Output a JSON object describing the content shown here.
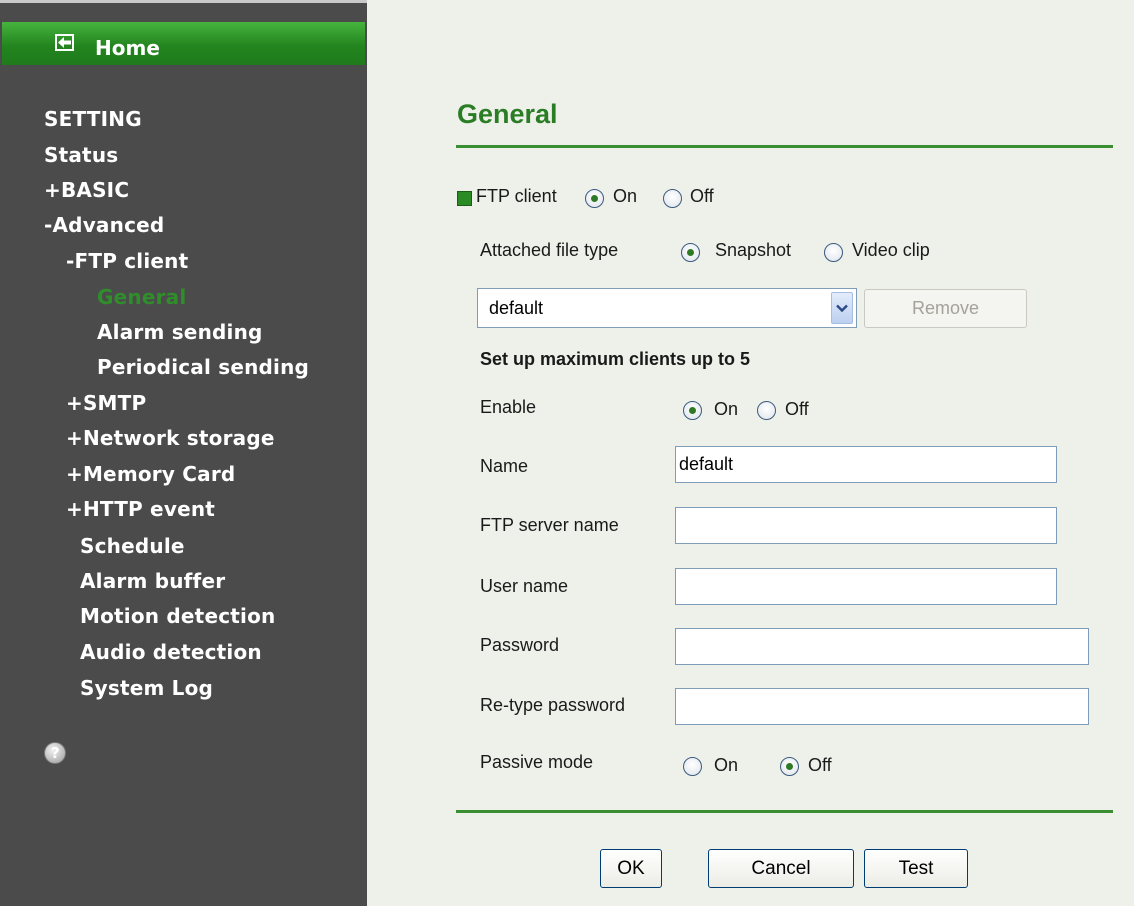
{
  "sidebar": {
    "home_label": "Home",
    "items": [
      {
        "label": "SETTING"
      },
      {
        "label": "Status"
      },
      {
        "label": "+BASIC"
      },
      {
        "label": "-Advanced"
      },
      {
        "label": "-FTP client"
      },
      {
        "label": "General",
        "active": true
      },
      {
        "label": "Alarm sending"
      },
      {
        "label": "Periodical sending"
      },
      {
        "label": "+SMTP"
      },
      {
        "label": "+Network storage"
      },
      {
        "label": "+Memory Card"
      },
      {
        "label": "+HTTP event"
      },
      {
        "label": "Schedule"
      },
      {
        "label": "Alarm buffer"
      },
      {
        "label": "Motion detection"
      },
      {
        "label": "Audio detection"
      },
      {
        "label": "System Log"
      }
    ],
    "help_icon": "question-mark-icon"
  },
  "main": {
    "title": "General",
    "ftp_client": {
      "label": "FTP client",
      "on_label": "On",
      "off_label": "Off",
      "value": "On"
    },
    "attached_file_type": {
      "label": "Attached file type",
      "snapshot_label": "Snapshot",
      "video_label": "Video clip",
      "value": "Snapshot"
    },
    "client_select": {
      "value": "default"
    },
    "remove_label": "Remove",
    "max_clients_text": "Set up maximum clients up to 5",
    "enable": {
      "label": "Enable",
      "on_label": "On",
      "off_label": "Off",
      "value": "On"
    },
    "name": {
      "label": "Name",
      "value": "default"
    },
    "ftp_server_name": {
      "label": "FTP server name",
      "value": ""
    },
    "user_name": {
      "label": "User name",
      "value": ""
    },
    "password": {
      "label": "Password",
      "value": ""
    },
    "retype_password": {
      "label": "Re-type password",
      "value": ""
    },
    "passive_mode": {
      "label": "Passive mode",
      "on_label": "On",
      "off_label": "Off",
      "value": "Off"
    },
    "buttons": {
      "ok": "OK",
      "cancel": "Cancel",
      "test": "Test"
    }
  },
  "colors": {
    "accent_green": "#2a7d24",
    "sidebar_bg": "#4b4b4b",
    "content_bg": "#eef1ea"
  }
}
